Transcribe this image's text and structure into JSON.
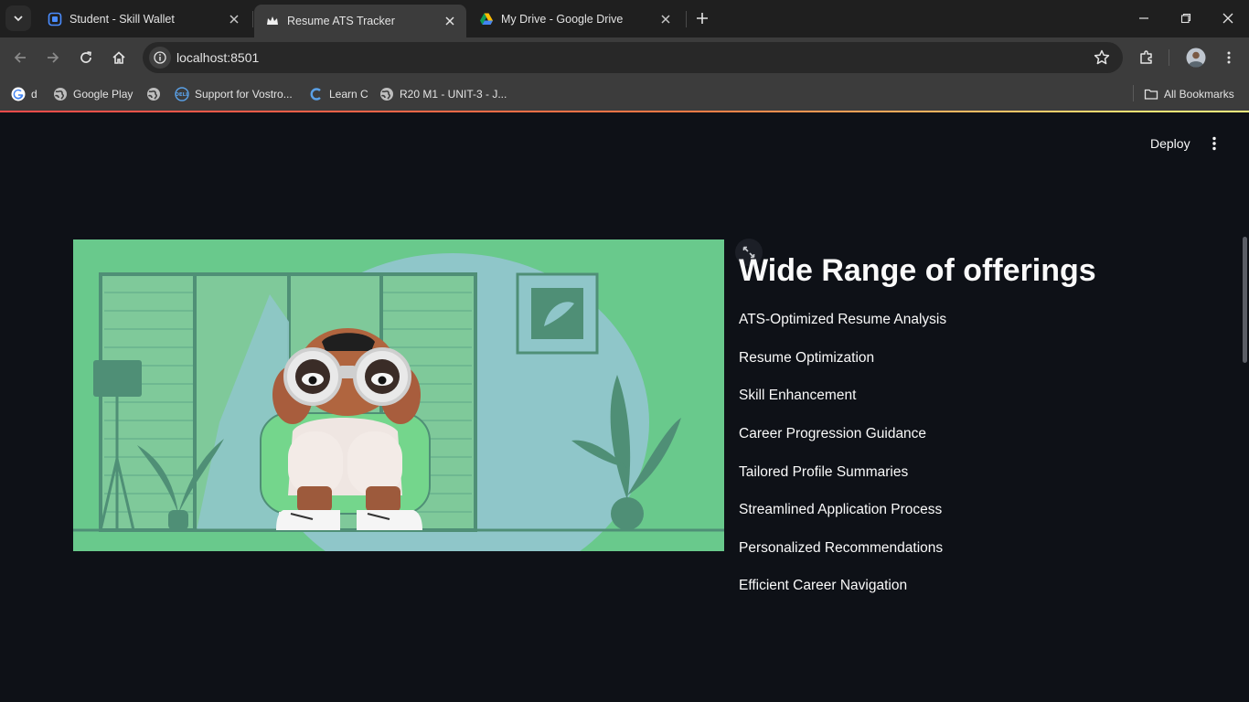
{
  "browser": {
    "tabs": [
      {
        "title": "Student - Skill Wallet",
        "icon": "skill-wallet-icon",
        "active": false
      },
      {
        "title": "Resume ATS Tracker",
        "icon": "streamlit-crown-icon",
        "active": true
      },
      {
        "title": "My Drive - Google Drive",
        "icon": "google-drive-icon",
        "active": false
      }
    ],
    "url": "localhost:8501",
    "bookmarks": [
      {
        "label": "d",
        "icon": "google-icon"
      },
      {
        "label": "Google Play",
        "icon": "globe-icon"
      },
      {
        "label": "",
        "icon": "globe-icon"
      },
      {
        "label": "Support for Vostro...",
        "icon": "dell-icon"
      },
      {
        "label": "Learn C",
        "icon": "c-logo-icon"
      },
      {
        "label": "R20 M1 - UNIT-3 - J...",
        "icon": "globe-icon"
      }
    ],
    "all_bookmarks_label": "All Bookmarks"
  },
  "app": {
    "deploy_label": "Deploy",
    "heading": "Wide Range of offerings",
    "offerings": [
      "ATS-Optimized Resume Analysis",
      "Resume Optimization",
      "Skill Enhancement",
      "Career Progression Guidance",
      "Tailored Profile Summaries",
      "Streamlined Application Process",
      "Personalized Recommendations",
      "Efficient Career Navigation"
    ]
  },
  "colors": {
    "page_bg": "#0e1117",
    "text": "#fafafa",
    "illustration_bg": "#69c98c",
    "accent_gradient_start": "#ff4b4b",
    "accent_gradient_end": "#fffd80"
  }
}
